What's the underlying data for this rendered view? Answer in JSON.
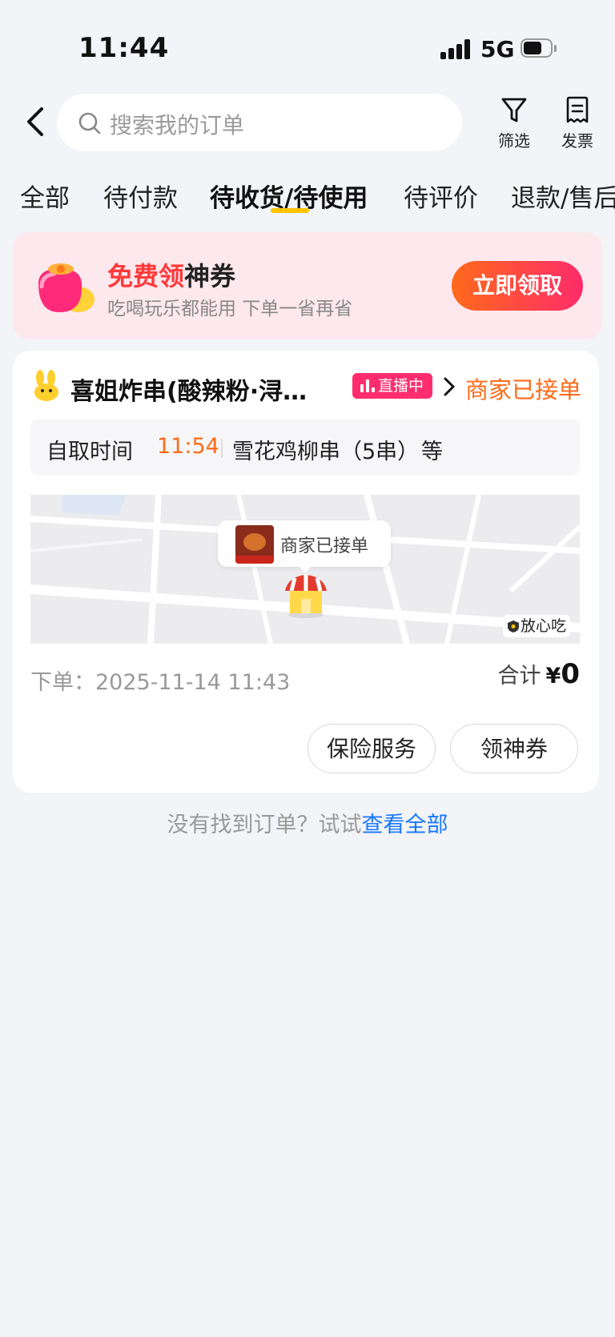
{
  "status_bar": {
    "time": "11:44",
    "network": "5G"
  },
  "header": {
    "search_placeholder": "搜索我的订单",
    "filter_label": "筛选",
    "invoice_label": "发票"
  },
  "tabs": [
    {
      "label": "全部",
      "active": false
    },
    {
      "label": "待付款",
      "active": false
    },
    {
      "label": "待收货/待使用",
      "active": true
    },
    {
      "label": "待评价",
      "active": false
    },
    {
      "label": "退款/售后",
      "active": false
    }
  ],
  "promo": {
    "title_red": "免费领",
    "title_black": "神券",
    "subtitle": "吃喝玩乐都能用 下单一省再省",
    "button": "立即领取"
  },
  "order": {
    "shop_name": "喜姐炸串(酸辣粉·浔…",
    "live_badge": "直播中",
    "status": "商家已接单",
    "pickup_label": "自取时间",
    "pickup_time": "11:54",
    "item_summary": "雪花鸡柳串（5串）",
    "item_more": "等",
    "map_bubble": "商家已接单",
    "safe_badge": "放心吃",
    "order_date": "下单：2025-11-14 11:43",
    "total_label": "合计",
    "total_currency": "¥",
    "total_amount": "0",
    "buttons": [
      "保险服务",
      "领神券"
    ]
  },
  "footer": {
    "hint": "没有找到订单？试试",
    "link": "查看全部"
  },
  "colors": {
    "accent_orange": "#ff6a17",
    "tab_underline": "#ffc300",
    "link_blue": "#1677ff",
    "live_pink": "#ff2d6f"
  }
}
